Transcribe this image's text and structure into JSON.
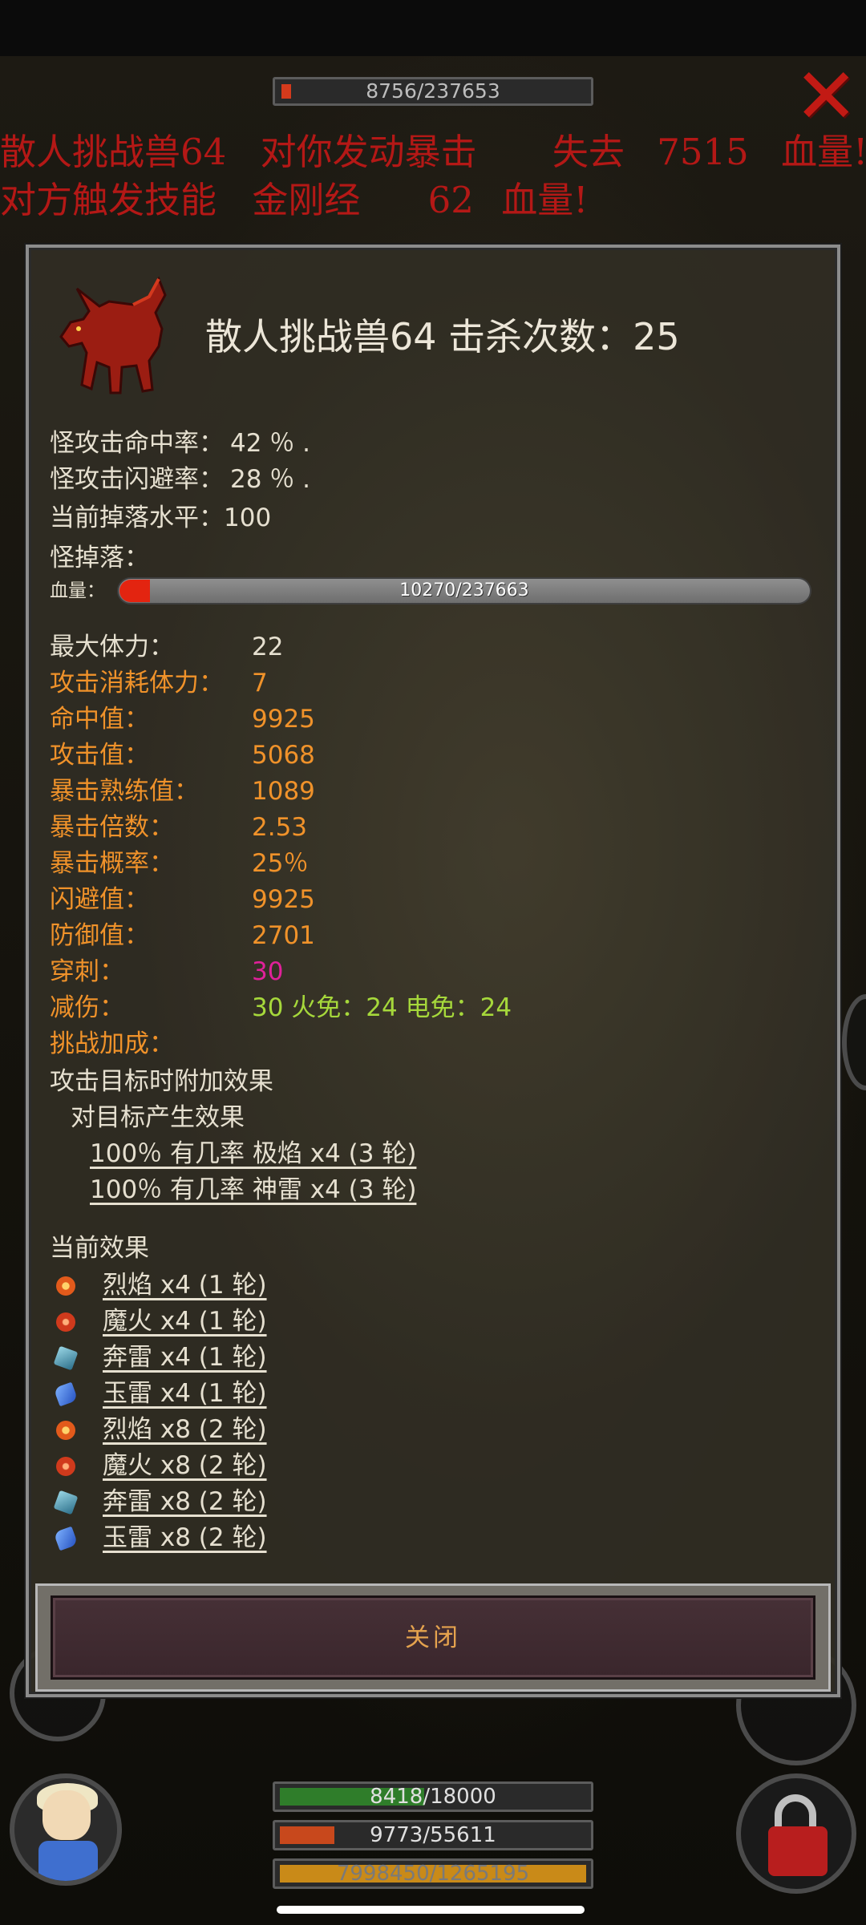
{
  "colors": {
    "log_red": "#b41816",
    "white_text": "#e6e0d0",
    "orange_text": "#f0922a",
    "magenta_text": "#e0219a",
    "green_text": "#a6d83b",
    "close_label": "#e5a34e"
  },
  "top_hp": {
    "text": "8756/237653",
    "fill_fraction": 0.04
  },
  "close_icon": "close-x-icon",
  "battle_log": [
    {
      "a": "散人挑战兽64",
      "b": "对你发动暴击",
      "c": "失去",
      "d": "7515",
      "e": "血量!"
    },
    {
      "a": "对方触发技能",
      "b": "金刚经",
      "c": "62",
      "d": "血量!"
    }
  ],
  "dialog": {
    "title": "散人挑战兽64  击杀次数：25",
    "stats_top": [
      {
        "label": "怪攻击命中率：",
        "value": "42 ％ ."
      },
      {
        "label": "怪攻击闪避率：",
        "value": "28 ％ ."
      },
      {
        "label": "当前掉落水平：",
        "value": "100"
      },
      {
        "label": "怪掉落：",
        "value": ""
      }
    ],
    "hp": {
      "label": "血量：",
      "text": "10270/237663",
      "fill_fraction": 0.043
    },
    "attributes": [
      {
        "label": "最大体力：",
        "value": "22"
      },
      {
        "label": "攻击消耗体力：",
        "value": "7"
      },
      {
        "label": "命中值：",
        "value": "9925"
      },
      {
        "label": "攻击值：",
        "value": "5068"
      },
      {
        "label": "暴击熟练值：",
        "value": "1089"
      },
      {
        "label": "暴击倍数：",
        "value": "2.53"
      },
      {
        "label": "暴击概率：",
        "value": "25％"
      },
      {
        "label": "闪避值：",
        "value": "9925"
      },
      {
        "label": "防御值：",
        "value": "2701"
      },
      {
        "label": "穿刺：",
        "value": "30"
      },
      {
        "label": "减伤：",
        "value": "30  火免：24  电免：24"
      },
      {
        "label": "挑战加成：",
        "value": ""
      }
    ],
    "attack_effects_heading": "攻击目标时附加效果",
    "target_effects_heading": "对目标产生效果",
    "target_effects": [
      "100％ 有几率 极焰 x4 (3 轮)",
      "100％ 有几率 神雷 x4 (3 轮)"
    ],
    "current_effects_heading": "当前效果",
    "current_effects": [
      {
        "icon": "flame-icon",
        "text": "烈焰 x4 (1 轮)"
      },
      {
        "icon": "demon-fire-icon",
        "text": "魔火 x4 (1 轮)"
      },
      {
        "icon": "thunder-icon",
        "text": "奔雷 x4 (1 轮)"
      },
      {
        "icon": "jade-thunder-icon",
        "text": "玉雷 x4 (1 轮)"
      },
      {
        "icon": "flame-icon",
        "text": "烈焰 x8 (2 轮)"
      },
      {
        "icon": "demon-fire-icon",
        "text": "魔火 x8 (2 轮)"
      },
      {
        "icon": "thunder-icon",
        "text": "奔雷 x8 (2 轮)"
      },
      {
        "icon": "jade-thunder-icon",
        "text": "玉雷 x8 (2 轮)"
      }
    ],
    "close_label": "关闭"
  },
  "player_bars": [
    {
      "name": "hp",
      "text": "8418/18000",
      "fill_fraction": 0.47,
      "color": "#2f7d2a"
    },
    {
      "name": "mp",
      "text": "9773/55611",
      "fill_fraction": 0.18,
      "color": "#c8481c"
    },
    {
      "name": "exp",
      "text": "7998450/1265195",
      "fill_fraction": 1.0,
      "color": "#c98a18"
    }
  ]
}
